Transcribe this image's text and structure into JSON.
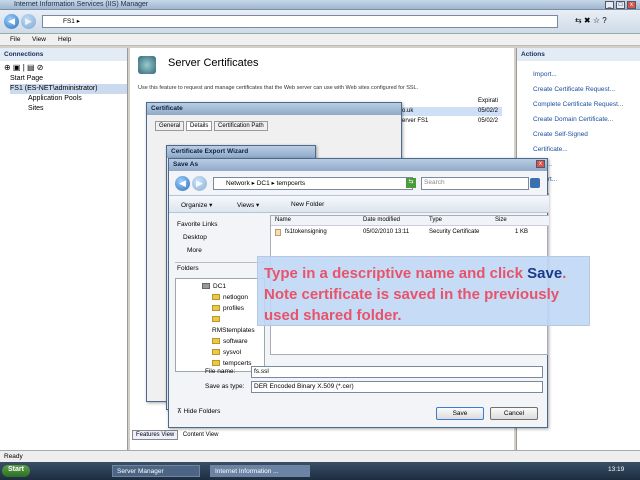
{
  "window": {
    "title": "Internet Information Services (IIS) Manager"
  },
  "address": {
    "crumbs": [
      "FS1"
    ]
  },
  "menu": [
    "File",
    "View",
    "Help"
  ],
  "connections": {
    "title": "Connections",
    "tree": [
      "Start Page",
      "FS1 (ES-NET\\administrator)",
      "Application Pools",
      "Sites"
    ]
  },
  "main": {
    "title": "Server Certificates",
    "description": "Use this feature to request and manage certificates that the Web server can use with Web sites configured for SSL.",
    "right_cols": [
      "Expirati",
      "05/02/2",
      "05/02/2"
    ],
    "right_names": [
      "o.uk",
      "erver FS1"
    ]
  },
  "actions": {
    "title": "Actions",
    "items": [
      "Import...",
      "Create Certificate Request...",
      "Complete Certificate Request...",
      "Create Domain Certificate...",
      "Create Self-Signed Certificate...",
      "View...",
      "Export...",
      "...ove",
      "Help"
    ]
  },
  "bottom_tabs": [
    "Features View",
    "Content View"
  ],
  "status": "Ready",
  "cert_dialog": {
    "title": "Certificate",
    "tabs": [
      "General",
      "Details",
      "Certification Path"
    ]
  },
  "wizard": {
    "title": "Certificate Export Wizard"
  },
  "saveas": {
    "title": "Save As",
    "path": [
      "Network",
      "DC1",
      "tempcerts"
    ],
    "search_placeholder": "Search",
    "toolbar": [
      "Organize",
      "Views",
      "New Folder"
    ],
    "fav_title": "Favorite Links",
    "fav": [
      "Desktop",
      "More"
    ],
    "folders_title": "Folders",
    "folders": [
      "DC1",
      "netlogon",
      "profiles",
      "RMStemplates",
      "software",
      "sysvol",
      "tempcerts"
    ],
    "columns": [
      "Name",
      "Date modified",
      "Type",
      "Size"
    ],
    "files": [
      {
        "name": "fs1tokensigning",
        "date": "05/02/2010 13:11",
        "type": "Security Certificate",
        "size": "1 KB"
      }
    ],
    "filename_label": "File name:",
    "filename": "fs.ssl",
    "type_label": "Save as type:",
    "type": "DER Encoded Binary X.509 (*.cer)",
    "hide": "Hide Folders",
    "save": "Save",
    "cancel": "Cancel"
  },
  "callout": {
    "pre": "Type in a descriptive name and click ",
    "bold": "Save",
    "post": ". Note certificate is saved in the previously used shared folder."
  },
  "taskbar": {
    "start": "Start",
    "tasks": [
      "Server Manager",
      "Internet Information ..."
    ],
    "clock": "13:19"
  }
}
